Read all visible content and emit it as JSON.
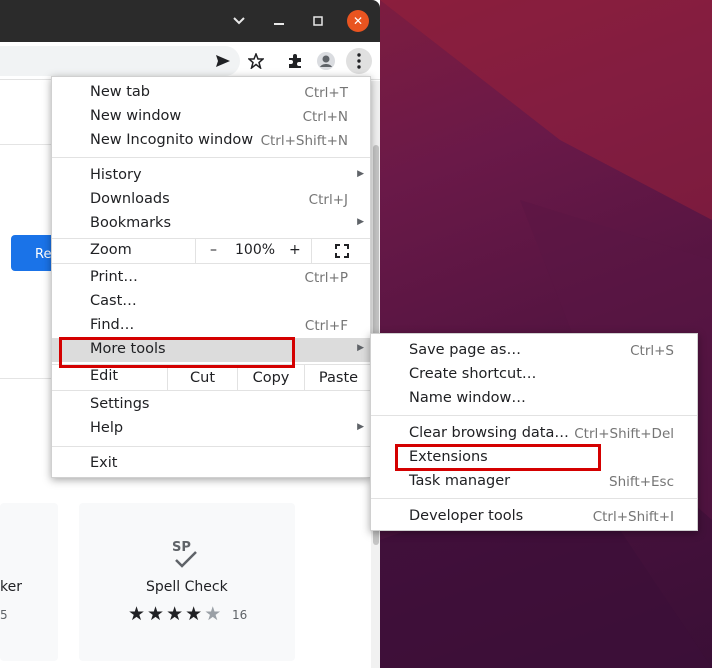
{
  "window": {
    "controls": [
      "chevron-down",
      "minimize",
      "maximize",
      "close"
    ]
  },
  "toolbar": {
    "icons": [
      "send-tab-icon",
      "bookmark-star-icon",
      "extensions-puzzle-icon",
      "profile-icon",
      "more-menu-icon"
    ]
  },
  "page": {
    "blue_button_label": "Re",
    "cards": [
      {
        "title": "ker",
        "rating_count": "5"
      },
      {
        "title": "Spell Check",
        "stars_filled": 4,
        "stars_total": 5,
        "rating_count": "16",
        "icon_text": "SP"
      }
    ]
  },
  "main_menu": {
    "new_tab": {
      "label": "New tab",
      "shortcut": "Ctrl+T"
    },
    "new_window": {
      "label": "New window",
      "shortcut": "Ctrl+N"
    },
    "new_incognito": {
      "label": "New Incognito window",
      "shortcut": "Ctrl+Shift+N"
    },
    "history": {
      "label": "History"
    },
    "downloads": {
      "label": "Downloads",
      "shortcut": "Ctrl+J"
    },
    "bookmarks": {
      "label": "Bookmarks"
    },
    "zoom": {
      "label": "Zoom",
      "minus": "–",
      "value": "100%",
      "plus": "+"
    },
    "print": {
      "label": "Print…",
      "shortcut": "Ctrl+P"
    },
    "cast": {
      "label": "Cast…"
    },
    "find": {
      "label": "Find…",
      "shortcut": "Ctrl+F"
    },
    "more_tools": {
      "label": "More tools"
    },
    "edit": {
      "label": "Edit",
      "cut": "Cut",
      "copy": "Copy",
      "paste": "Paste"
    },
    "settings": {
      "label": "Settings"
    },
    "help": {
      "label": "Help"
    },
    "exit": {
      "label": "Exit"
    }
  },
  "sub_menu": {
    "save_page": {
      "label": "Save page as…",
      "shortcut": "Ctrl+S"
    },
    "create_shortcut": {
      "label": "Create shortcut…"
    },
    "name_window": {
      "label": "Name window…"
    },
    "clear_data": {
      "label": "Clear browsing data…",
      "shortcut": "Ctrl+Shift+Del"
    },
    "extensions": {
      "label": "Extensions"
    },
    "task_manager": {
      "label": "Task manager",
      "shortcut": "Shift+Esc"
    },
    "dev_tools": {
      "label": "Developer tools",
      "shortcut": "Ctrl+Shift+I"
    }
  },
  "colors": {
    "accent_blue": "#1a73e8",
    "annotation_red": "#d40000",
    "close_button": "#e95420"
  }
}
